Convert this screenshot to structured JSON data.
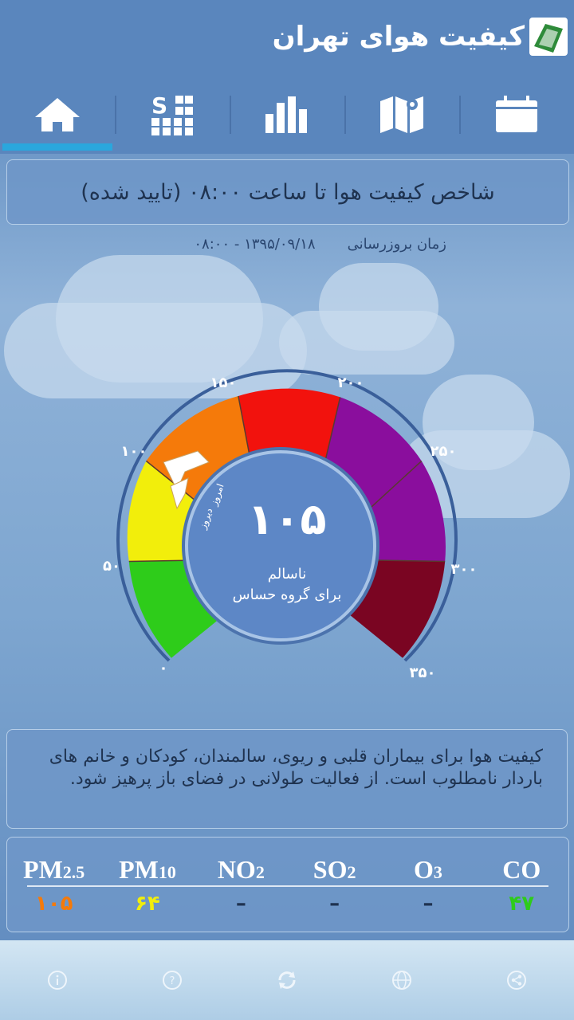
{
  "app": {
    "title": "کیفیت هوای تهران"
  },
  "tabs": [
    "calendar-icon",
    "map-icon",
    "bar-chart-icon",
    "stations-icon",
    "home-icon"
  ],
  "aqi": {
    "title": "شاخص کیفیت هوا تا ساعت ۰۸:۰۰ (تایید شده)",
    "update_label": "زمان بروزرسانی",
    "update_value": "۱۳۹۵/۰۹/۱۸ - ۰۸:۰۰",
    "value": "۱۰۵",
    "status": "ناسالم",
    "status_group": "برای گروه حساس",
    "today": "امروز",
    "yesterday": "دیروز",
    "scale": [
      "۰",
      "۵۰",
      "۱۰۰",
      "۱۵۰",
      "۲۰۰",
      "۲۵۰",
      "۳۰۰",
      "۳۵۰"
    ],
    "colors": [
      "#2ecc1a",
      "#f2ee0b",
      "#f57a0a",
      "#f2120d",
      "#8a0e9d",
      "#8a0e9d",
      "#7a0522"
    ]
  },
  "description": "کیفیت هوا برای بیماران قلبی و ریوی، سالمندان، کودکان و خانم های باردار نامطلوب است. از فعالیت طولانی در فضای باز پرهیز شود.",
  "pollutants": [
    {
      "name": "PM",
      "sub": "2.5",
      "value": "۱۰۵",
      "color": "#f57a0a"
    },
    {
      "name": "PM",
      "sub": "10",
      "value": "۶۴",
      "color": "#f2ee0b"
    },
    {
      "name": "NO",
      "sub": "2",
      "value": "–",
      "color": "#1f3350"
    },
    {
      "name": "SO",
      "sub": "2",
      "value": "–",
      "color": "#1f3350"
    },
    {
      "name": "O",
      "sub": "3",
      "value": "–",
      "color": "#1f3350"
    },
    {
      "name": "CO",
      "sub": "",
      "value": "۴۷",
      "color": "#2ecc1a"
    }
  ],
  "footer": [
    "info-icon",
    "help-icon",
    "refresh-icon",
    "globe-icon",
    "share-icon"
  ]
}
